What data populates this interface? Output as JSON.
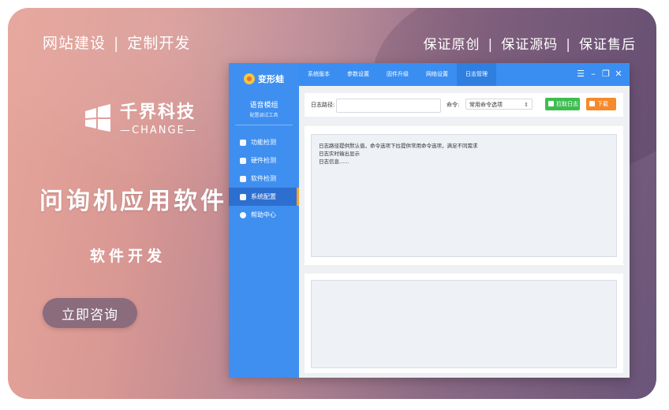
{
  "banner": {
    "top_left": [
      "网站建设",
      "定制开发"
    ],
    "top_right": [
      "保证原创",
      "保证源码",
      "保证售后"
    ],
    "brand_cn": "千界科技",
    "brand_en": "CHANGE",
    "headline": "问询机应用软件",
    "subline": "软件开发",
    "consult_button": "立即咨询"
  },
  "app": {
    "logo_text": "变形蛙",
    "module_title": "语音模组",
    "module_subtitle": "配置调试工具",
    "nav": [
      {
        "label": "功能检测",
        "icon": "cube-icon"
      },
      {
        "label": "硬件检测",
        "icon": "hardware-icon"
      },
      {
        "label": "软件检测",
        "icon": "software-icon"
      },
      {
        "label": "系统配置",
        "icon": "gear-icon",
        "active": true
      },
      {
        "label": "帮助中心",
        "icon": "help-icon"
      }
    ],
    "tabs": [
      {
        "label": "系统版本"
      },
      {
        "label": "参数设置"
      },
      {
        "label": "固件升级"
      },
      {
        "label": "网络设置"
      },
      {
        "label": "日志管理",
        "active": true
      }
    ],
    "toolbar": {
      "path_label": "日志路径:",
      "path_value": "",
      "cmd_label": "命令:",
      "cmd_value": "常用命令选项",
      "pull_button": "拉取日志",
      "download_button": "下载"
    },
    "log_lines": [
      "日志路径提供默认值，命令选项下拉提供常用命令选项，满足不同需求",
      "日志实时输出显示",
      "日志信息......"
    ],
    "colors": {
      "sidebar": "#3e8ff0",
      "active_marker": "#f6a22a",
      "pull_button": "#3dbd4f",
      "download_button": "#f5892b"
    }
  }
}
